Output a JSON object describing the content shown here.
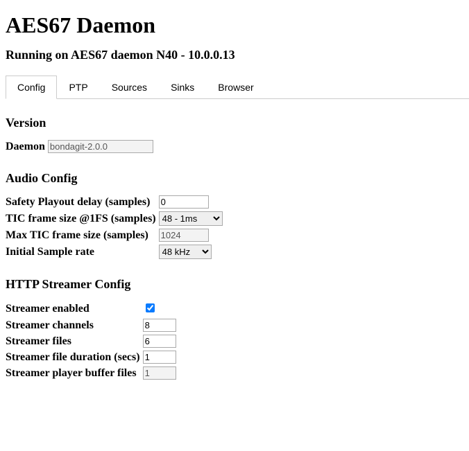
{
  "page_title": "AES67 Daemon",
  "subtitle": "Running on AES67 daemon N40 - 10.0.0.13",
  "tabs": {
    "config": "Config",
    "ptp": "PTP",
    "sources": "Sources",
    "sinks": "Sinks",
    "browser": "Browser"
  },
  "section": {
    "version": "Version",
    "audio": "Audio Config",
    "http": "HTTP Streamer Config"
  },
  "version": {
    "daemon_label": "Daemon",
    "daemon_value": "bondagit-2.0.0"
  },
  "audio": {
    "safety_label": "Safety Playout delay (samples)",
    "safety_value": "0",
    "tic1fs_label": "TIC frame size @1FS (samples)",
    "tic1fs_selected": "48 - 1ms",
    "maxtic_label": "Max TIC frame size (samples)",
    "maxtic_value": "1024",
    "srate_label": "Initial Sample rate",
    "srate_selected": "48 kHz"
  },
  "http": {
    "enabled_label": "Streamer enabled",
    "enabled": true,
    "channels_label": "Streamer channels",
    "channels_value": "8",
    "files_label": "Streamer files",
    "files_value": "6",
    "dur_label": "Streamer file duration (secs)",
    "dur_value": "1",
    "buf_label": "Streamer player buffer files",
    "buf_value": "1"
  }
}
